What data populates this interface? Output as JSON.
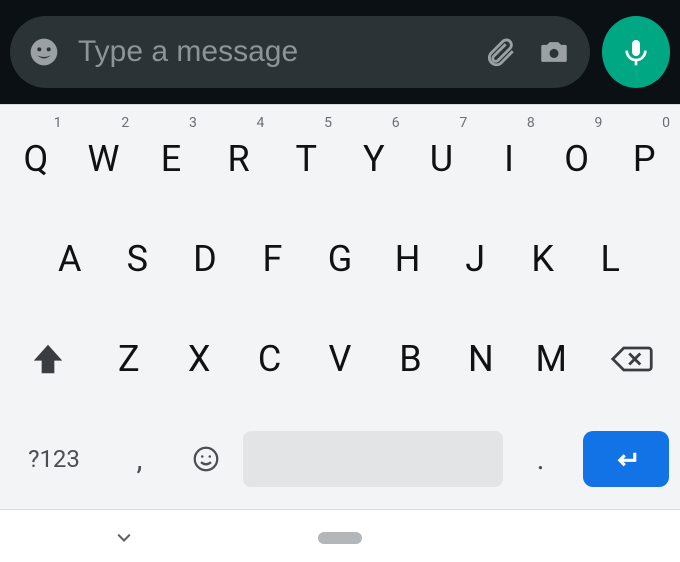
{
  "input": {
    "placeholder": "Type a message",
    "value": ""
  },
  "keyboard": {
    "row1": [
      {
        "k": "Q",
        "h": "1"
      },
      {
        "k": "W",
        "h": "2"
      },
      {
        "k": "E",
        "h": "3"
      },
      {
        "k": "R",
        "h": "4"
      },
      {
        "k": "T",
        "h": "5"
      },
      {
        "k": "Y",
        "h": "6"
      },
      {
        "k": "U",
        "h": "7"
      },
      {
        "k": "I",
        "h": "8"
      },
      {
        "k": "O",
        "h": "9"
      },
      {
        "k": "P",
        "h": "0"
      }
    ],
    "row2": [
      "A",
      "S",
      "D",
      "F",
      "G",
      "H",
      "J",
      "K",
      "L"
    ],
    "row3": [
      "Z",
      "X",
      "C",
      "V",
      "B",
      "N",
      "M"
    ],
    "symbols": "?123",
    "comma": ",",
    "period": "."
  }
}
